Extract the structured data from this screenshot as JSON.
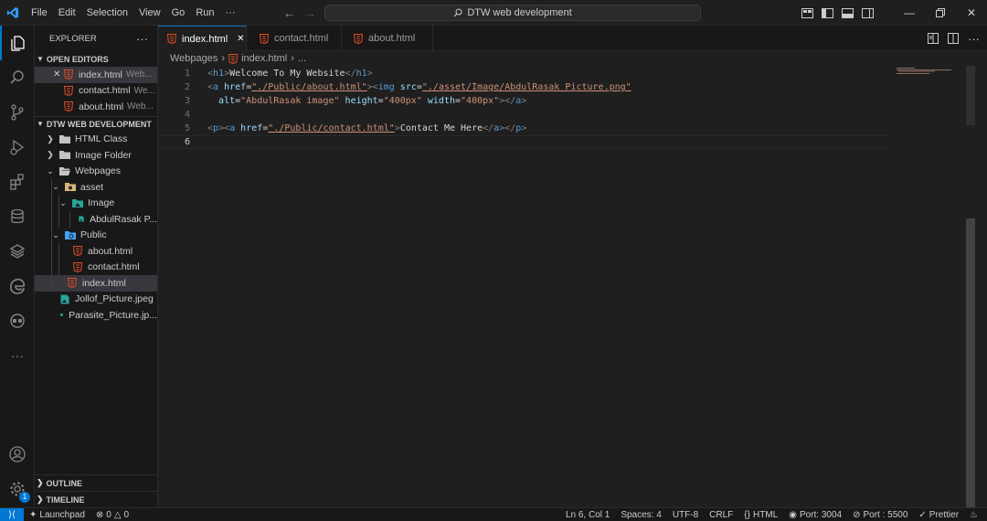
{
  "titlebar": {
    "menu": [
      "File",
      "Edit",
      "Selection",
      "View",
      "Go",
      "Run",
      "···"
    ],
    "search_text": "DTW web development"
  },
  "explorer": {
    "title": "EXPLORER",
    "more": "···",
    "open_editors_title": "OPEN EDITORS",
    "open_editors": [
      {
        "name": "index.html",
        "desc": "Web..."
      },
      {
        "name": "contact.html",
        "desc": "We..."
      },
      {
        "name": "about.html",
        "desc": "Web..."
      }
    ],
    "workspace_title": "DTW WEB DEVELOPMENT",
    "tree": {
      "html_class": "HTML Class",
      "image_folder": "Image Folder",
      "webpages": "Webpages",
      "asset": "asset",
      "image": "Image",
      "abdulrasak": "AbdulRasak P...",
      "public": "Public",
      "about": "about.html",
      "contact": "contact.html",
      "index": "index.html",
      "jollof": "Jollof_Picture.jpeg",
      "parasite": "Parasite_Picture.jp..."
    },
    "outline": "OUTLINE",
    "timeline": "TIMELINE"
  },
  "tabs": [
    {
      "label": "index.html"
    },
    {
      "label": "contact.html"
    },
    {
      "label": "about.html"
    }
  ],
  "breadcrumb": {
    "folder": "Webpages",
    "file": "index.html",
    "rest": "..."
  },
  "editor": {
    "line_numbers": [
      "1",
      "2",
      "3",
      "4",
      "5",
      "6"
    ],
    "line1": {
      "open": "h1",
      "text": "Welcome To My Website",
      "close": "h1"
    },
    "line2": {
      "a": "a",
      "href_attr": "href",
      "href_val": "\"./Public/about.html\"",
      "img": "img",
      "src_attr": "src",
      "src_val": "\"./asset/Image/AbdulRasak Picture.png\""
    },
    "line3": {
      "alt_attr": "alt",
      "alt_val": "\"AbdulRasak image\"",
      "height_attr": "height",
      "height_val": "\"400px\"",
      "width_attr": "width",
      "width_val": "\"400px\"",
      "close": "a"
    },
    "line5": {
      "p": "p",
      "a": "a",
      "href_attr": "href",
      "href_val": "\"./Public/contact.html\"",
      "text": "Contact Me Here",
      "close_a": "a",
      "close_p": "p"
    }
  },
  "statusbar": {
    "launchpad": "Launchpad",
    "errors": "0",
    "warnings": "0",
    "position": "Ln 6, Col 1",
    "spaces": "Spaces: 4",
    "encoding": "UTF-8",
    "eol": "CRLF",
    "language": "HTML",
    "port1": "Port: 3004",
    "port2": "Port : 5500",
    "prettier": "Prettier"
  },
  "activity_badge": "1",
  "colors": {
    "accent": "#0078d4",
    "html_icon": "#e44d26",
    "folder": "#dcb67a",
    "image_icon": "#26a69a"
  }
}
